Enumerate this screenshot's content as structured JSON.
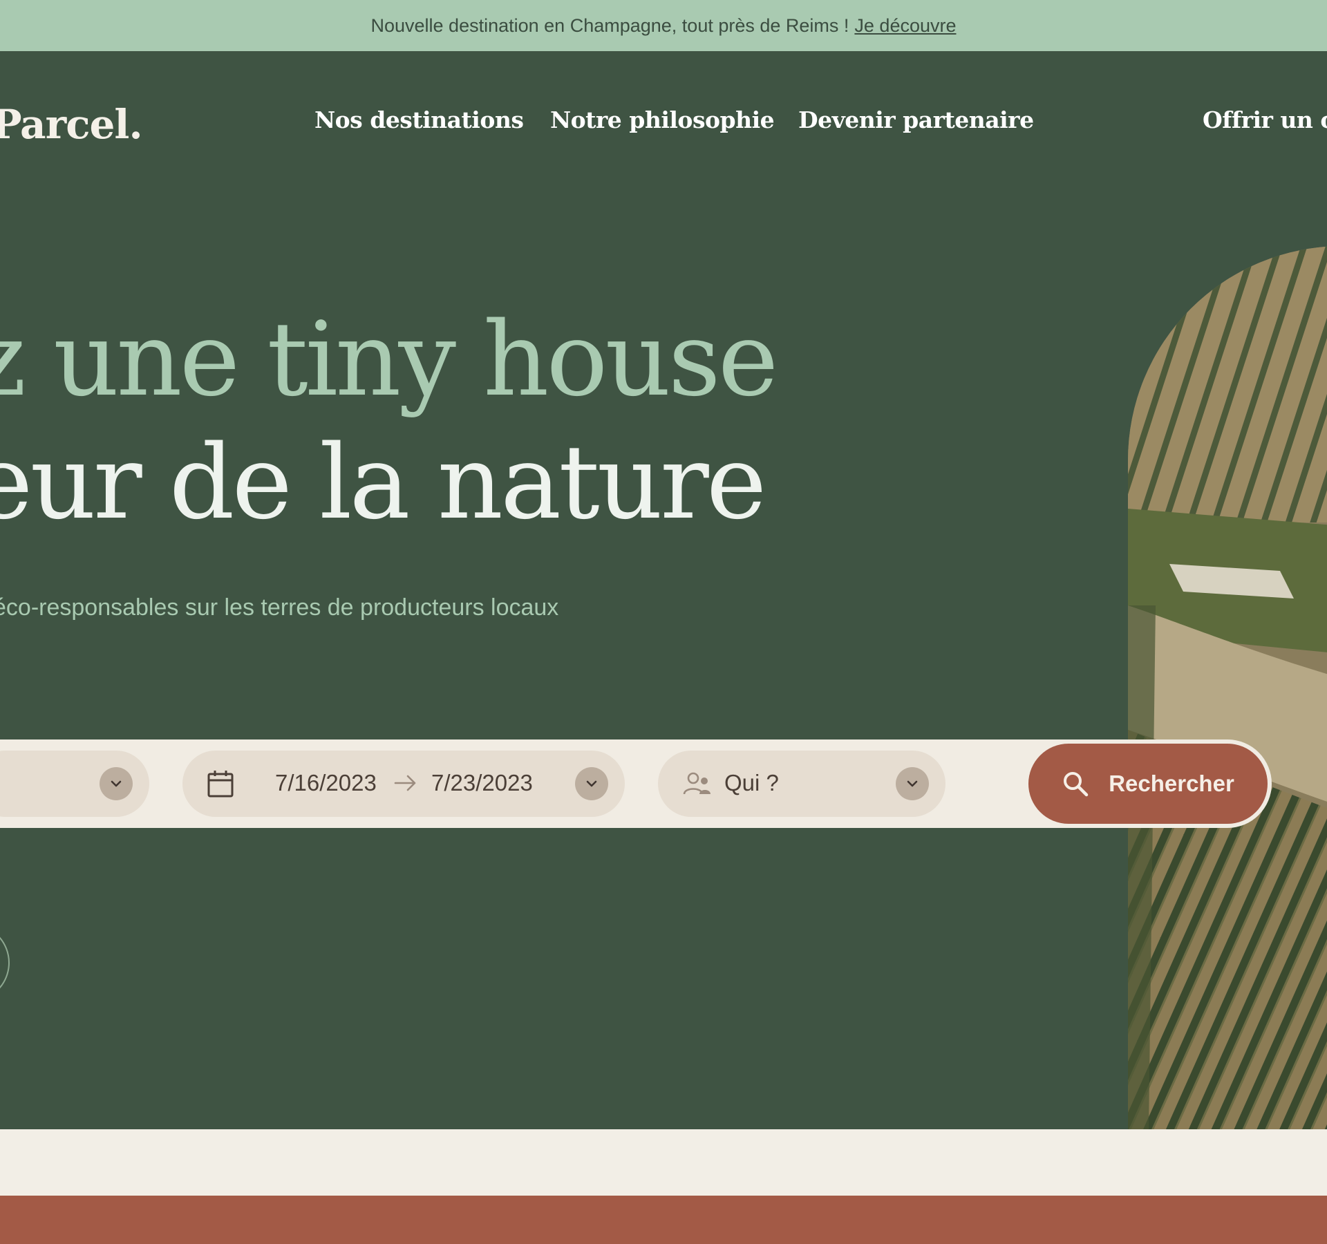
{
  "announcement": {
    "text": "Nouvelle destination en Champagne, tout près de Reims !",
    "link": "Je découvre"
  },
  "header": {
    "logo": "Parcel.",
    "nav": [
      "Nos destinations",
      "Notre philosophie",
      "Devenir partenaire",
      "Offrir un ca"
    ]
  },
  "hero": {
    "title_line1": "z une tiny house",
    "title_line2": "eur de la nature",
    "subtitle": "éco-responsables sur les terres de producteurs locaux"
  },
  "search": {
    "date_from": "7/16/2023",
    "date_to": "7/23/2023",
    "guests_placeholder": "Qui ?",
    "button_label": "Rechercher"
  },
  "colors": {
    "hero_bg": "#3f5443",
    "accent": "#a35a46",
    "mint": "#a9cab1",
    "cream": "#f1ece3"
  },
  "icons": [
    "calendar-icon",
    "arrow-right-icon",
    "users-icon",
    "chevron-down-icon",
    "search-icon"
  ]
}
